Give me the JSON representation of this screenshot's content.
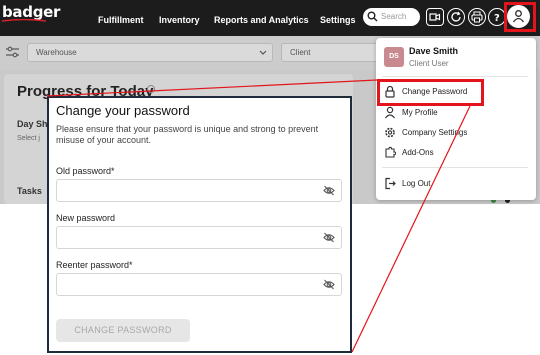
{
  "brand": {
    "name": "badger",
    "tagline": ""
  },
  "nav": {
    "links": [
      "Fulfillment",
      "Inventory",
      "Reports and Analytics",
      "Settings"
    ],
    "search_placeholder": "Search",
    "icons": [
      "video-icon",
      "refresh-icon",
      "printer-icon",
      "help-icon",
      "user-icon"
    ]
  },
  "filters": {
    "warehouse_placeholder": "Warehouse",
    "client_placeholder": "Client"
  },
  "dashboard": {
    "title": "Progress for Today",
    "day_label": "Day Sh",
    "select_hint": "Select j",
    "tasks_label": "Tasks"
  },
  "modal": {
    "title": "Change your password",
    "description": "Please ensure that your password is unique and strong to prevent misuse of your account.",
    "fields": [
      {
        "label": "Old password*",
        "value": ""
      },
      {
        "label": "New password",
        "value": ""
      },
      {
        "label": "Reenter password*",
        "value": ""
      }
    ],
    "submit_label": "CHANGE PASSWORD"
  },
  "user_menu": {
    "initials": "DS",
    "name": "Dave Smith",
    "role": "Client User",
    "items": [
      {
        "label": "Change Password",
        "icon": "lock-icon"
      },
      {
        "label": "My Profile",
        "icon": "user-icon"
      },
      {
        "label": "Company Settings",
        "icon": "gear-icon"
      },
      {
        "label": "Add-Ons",
        "icon": "puzzle-icon"
      },
      {
        "label": "Log Out",
        "icon": "logout-icon"
      }
    ]
  },
  "colors": {
    "highlight": "#e3141b",
    "nav_bg": "#1c1c1c",
    "avatar_bg": "#c98a8f",
    "modal_border": "#1e2b3a"
  }
}
